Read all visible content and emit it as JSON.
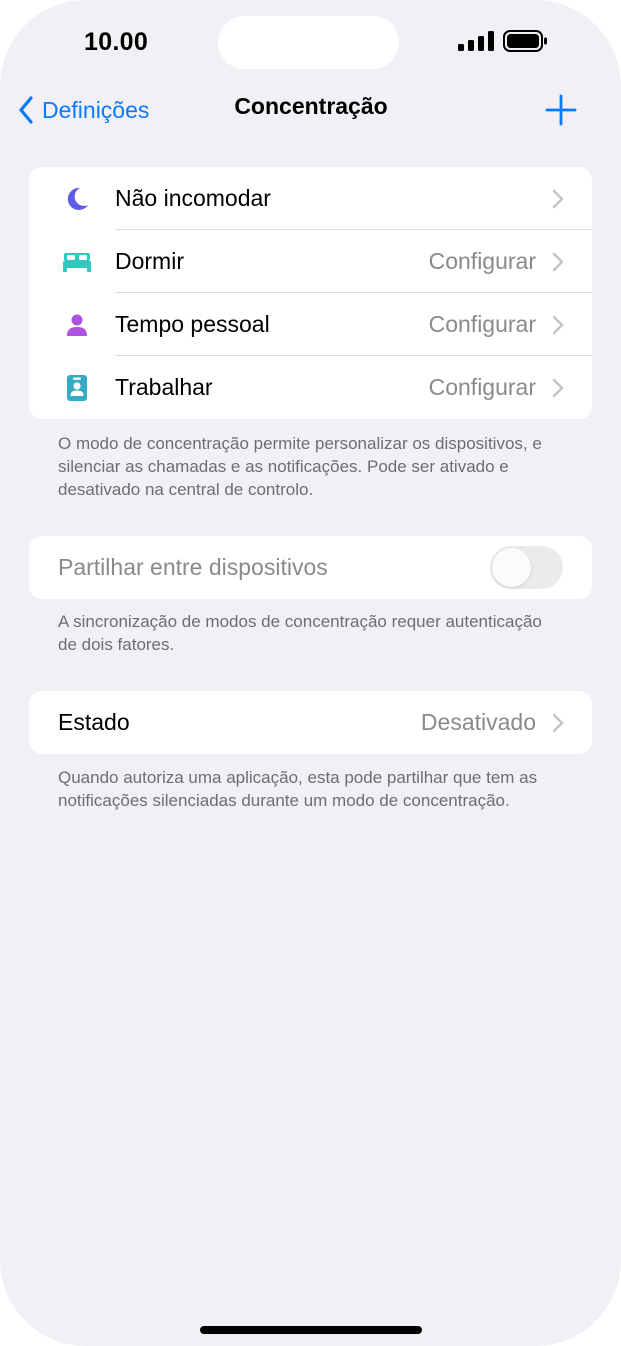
{
  "status_bar": {
    "time": "10.00",
    "signal_icon": "cellular-signal-icon",
    "battery_icon": "battery-icon"
  },
  "nav": {
    "back_label": "Definições",
    "back_icon": "chevron-left-icon",
    "title": "Concentração",
    "add_icon": "plus-icon",
    "accent_color": "#0a7aff"
  },
  "focus_modes": [
    {
      "label": "Não incomodar",
      "value": "",
      "icon": "moon-icon",
      "icon_color": "#5e5ce6"
    },
    {
      "label": "Dormir",
      "value": "Configurar",
      "icon": "bed-icon",
      "icon_color": "#30c7be"
    },
    {
      "label": "Tempo pessoal",
      "value": "Configurar",
      "icon": "person-icon",
      "icon_color": "#af52de"
    },
    {
      "label": "Trabalhar",
      "value": "Configurar",
      "icon": "id-badge-icon",
      "icon_color": "#35aac3"
    }
  ],
  "focus_footnote": "O modo de concentração permite personalizar os dispositivos, e silenciar as chamadas e as notificações. Pode ser ativado e desativado na central de controlo.",
  "share_across_devices": {
    "label": "Partilhar entre dispositivos",
    "enabled": false,
    "disabled_state": true
  },
  "share_footnote": "A sincronização de modos de concentração requer autenticação de dois fatores.",
  "focus_status": {
    "label": "Estado",
    "value": "Desativado"
  },
  "status_footnote": "Quando autoriza uma aplicação, esta pode partilhar que tem as notificações silenciadas durante um modo de concentração."
}
